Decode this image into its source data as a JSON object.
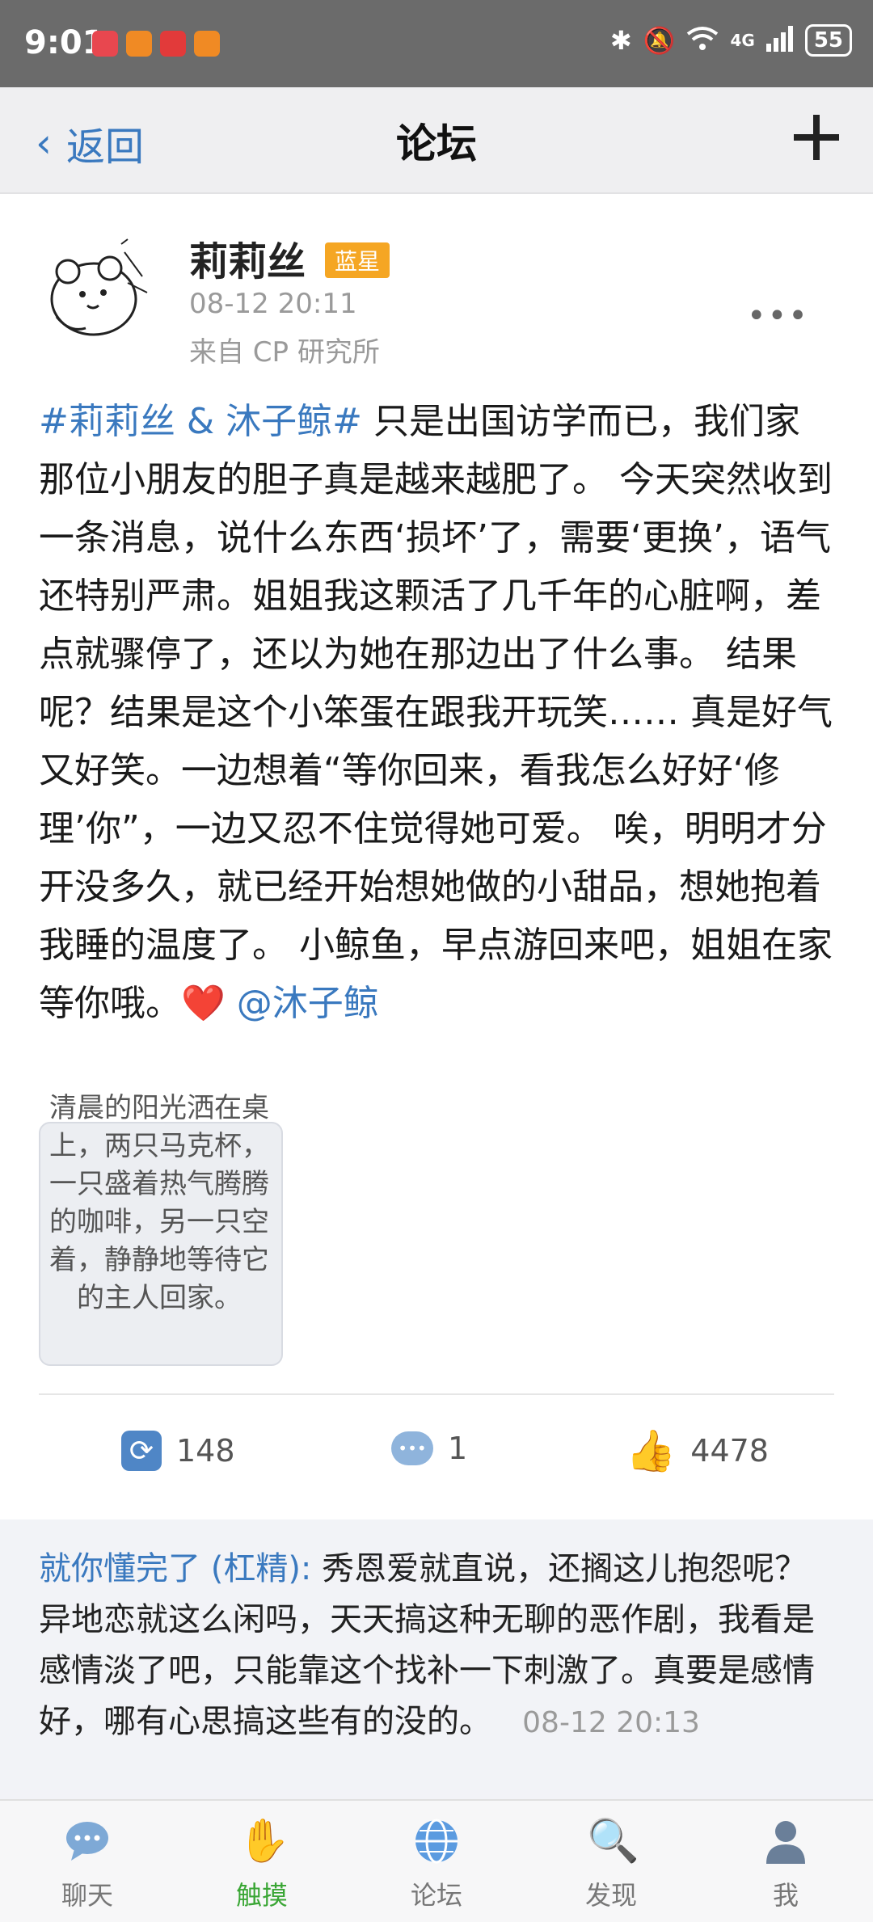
{
  "status_bar": {
    "time": "9:01",
    "battery": "55",
    "network": "4G"
  },
  "nav": {
    "back_label": "返回",
    "title": "论坛"
  },
  "post": {
    "author": "莉莉丝",
    "badge": "蓝星",
    "date": "08-12 20:11",
    "source": "来自 CP 研究所",
    "hashtag": "#莉莉丝 & 沐子鲸#",
    "body": " 只是出国访学而已，我们家那位小朋友的胆子真是越来越肥了。 今天突然收到一条消息，说什么东西‘损坏’了，需要‘更换’，语气还特别严肃。姐姐我这颗活了几千年的心脏啊，差点就骤停了，还以为她在那边出了什么事。 结果呢？结果是这个小笨蛋在跟我开玩笑…… 真是好气又好笑。一边想着“等你回来，看我怎么好好‘修理’你”，一边又忍不住觉得她可爱。 唉，明明才分开没多久，就已经开始想她做的小甜品，想她抱着我睡的温度了。 小鲸鱼，早点游回来吧，姐姐在家等你哦。",
    "heart": "❤️",
    "mention": "@沐子鲸",
    "image_caption": "清晨的阳光洒在桌上，两只马克杯，一只盛着热气腾腾的咖啡，另一只空着，静静地等待它的主人回家。",
    "repost_count": "148",
    "comment_count": "1",
    "like_count": "4478"
  },
  "comment": {
    "name": "就你懂完了 (杠精):",
    "text": " 秀恩爱就直说，还搁这儿抱怨呢？异地恋就这么闲吗，天天搞这种无聊的恶作剧，我看是感情淡了吧，只能靠这个找补一下刺激了。真要是感情好，哪有心思搞这些有的没的。",
    "time": "08-12 20:13"
  },
  "tabs": [
    {
      "label": "聊天",
      "icon": "chat-icon"
    },
    {
      "label": "触摸",
      "icon": "hand-icon"
    },
    {
      "label": "论坛",
      "icon": "globe-icon"
    },
    {
      "label": "发现",
      "icon": "magnifier-icon"
    },
    {
      "label": "我",
      "icon": "person-icon"
    }
  ],
  "active_tab": "触摸",
  "colors": {
    "link": "#3a79bf",
    "badge": "#f5a623",
    "active_tab": "#3aa635"
  }
}
